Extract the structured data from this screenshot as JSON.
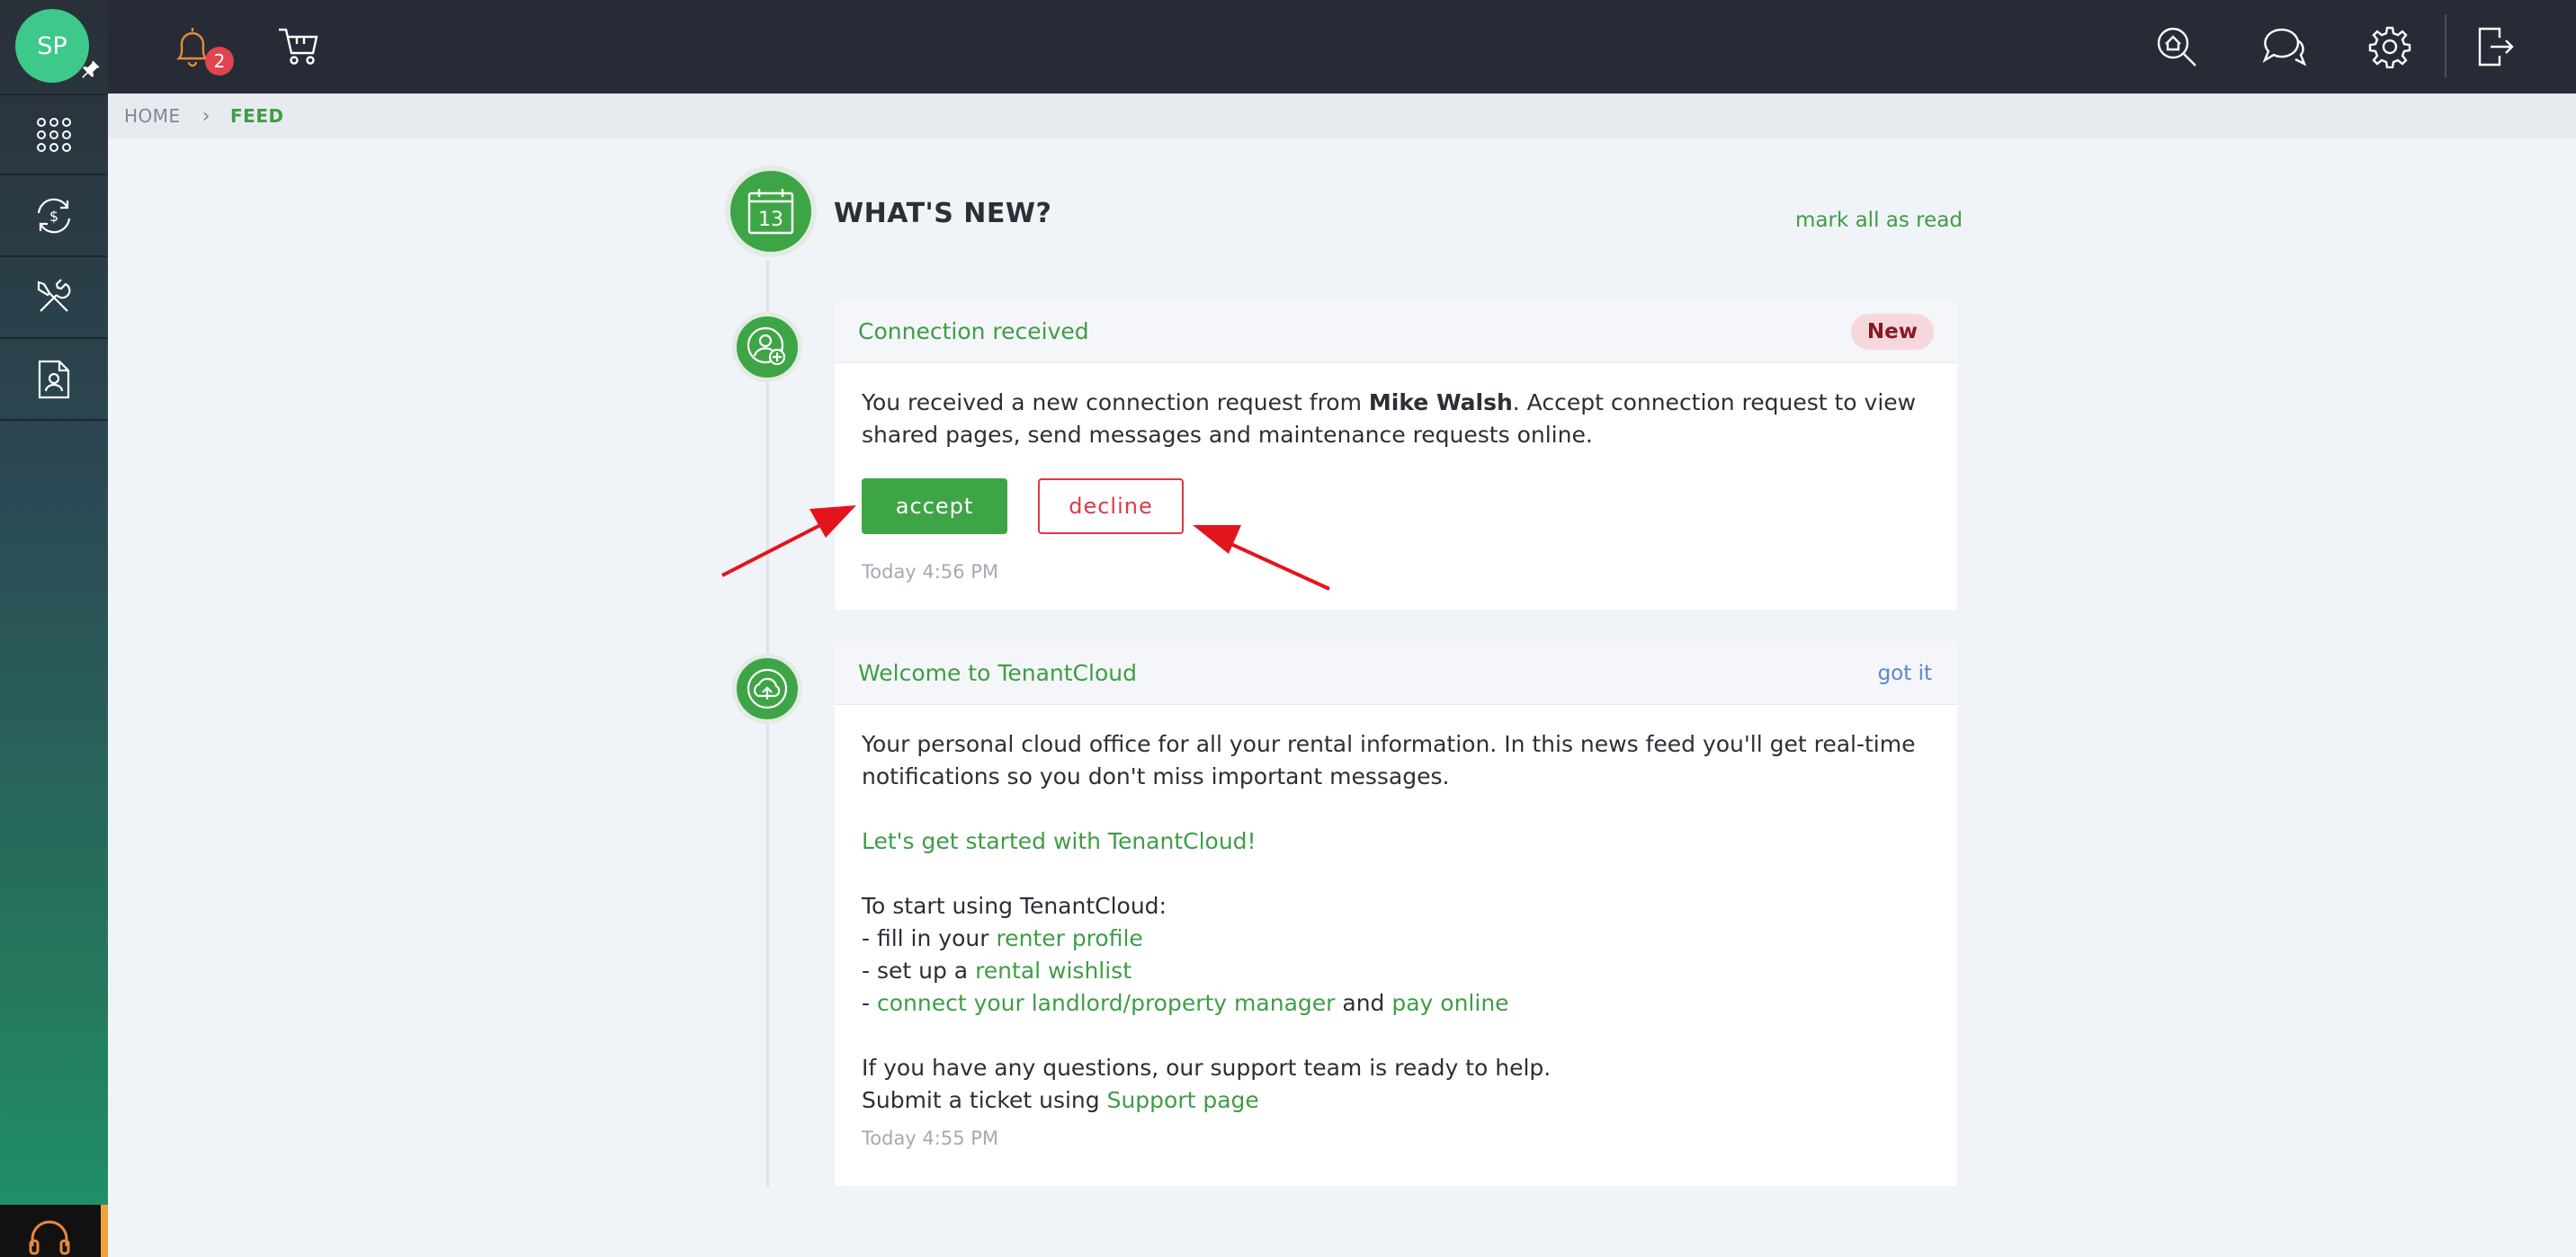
{
  "user": {
    "initials": "SP"
  },
  "notifications": {
    "count": "2"
  },
  "breadcrumb": {
    "home": "HOME",
    "separator": "›",
    "current": "FEED"
  },
  "feed": {
    "title": "WHAT'S NEW?",
    "calendar_day": "13",
    "mark_all": "mark all as read",
    "items": [
      {
        "title": "Connection received",
        "badge": "New",
        "text_before": "You received a new connection request from ",
        "name": "Mike Walsh",
        "text_after": ". Accept connection request to view shared pages, send messages and maintenance requests online.",
        "accept": "accept",
        "decline": "decline",
        "time": "Today 4:56 PM"
      },
      {
        "title": "Welcome to TenantCloud",
        "action": "got it",
        "intro": "Your personal cloud office for all your rental information. In this news feed you'll get real-time notifications so you don't miss important messages.",
        "cta": "Let's get started with TenantCloud!",
        "start_heading": "To start using TenantCloud:",
        "step1_prefix": "- fill in your ",
        "step1_link": "renter profile",
        "step2_prefix": "- set up a ",
        "step2_link": "rental wishlist",
        "step3_prefix": "- ",
        "step3_link1": "connect your landlord/property manager",
        "step3_mid": " and ",
        "step3_link2": "pay online",
        "help1": "If you have any questions, our support team is ready to help.",
        "help2_prefix": "Submit a ticket using ",
        "help2_link": "Support page",
        "time": "Today 4:55 PM"
      }
    ]
  },
  "colors": {
    "accent": "#3ea546",
    "decline": "#dc3a44",
    "topbar": "#272b35"
  },
  "icons": [
    "pin-icon",
    "apps-grid-icon",
    "payments-sync-icon",
    "tools-icon",
    "document-person-icon",
    "headset-icon",
    "bell-icon",
    "cart-icon",
    "search-home-icon",
    "chat-icon",
    "gear-icon",
    "logout-icon",
    "calendar-icon",
    "user-add-icon",
    "cloud-upload-icon"
  ]
}
